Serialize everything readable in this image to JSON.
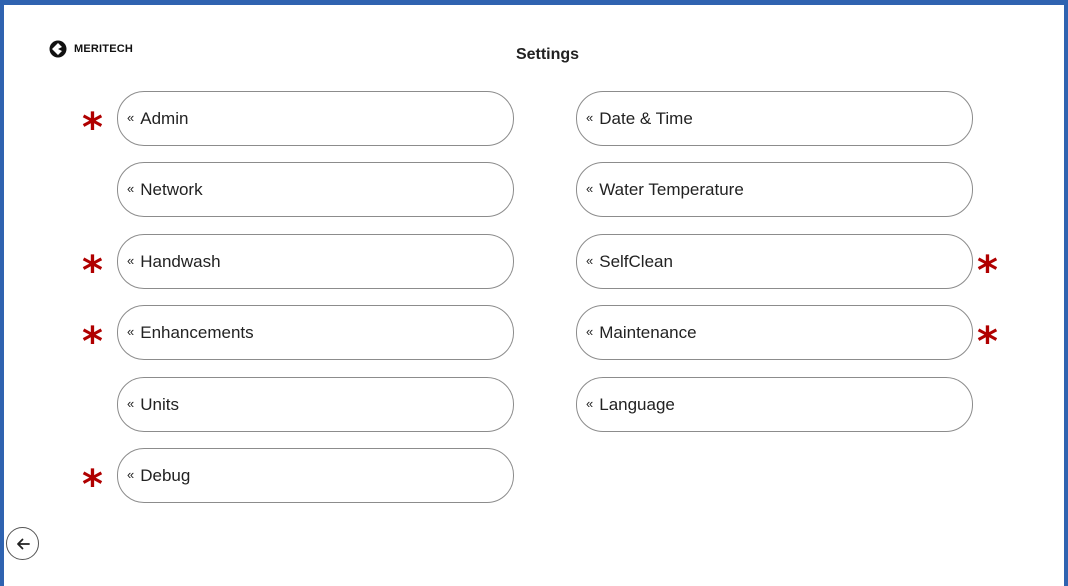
{
  "brand": {
    "name": "MERITECH"
  },
  "page": {
    "title": "Settings"
  },
  "chevron": "«",
  "left_column": [
    {
      "label": "Admin",
      "starred": true
    },
    {
      "label": "Network",
      "starred": false
    },
    {
      "label": "Handwash",
      "starred": true
    },
    {
      "label": "Enhancements",
      "starred": true
    },
    {
      "label": "Units",
      "starred": false
    },
    {
      "label": "Debug",
      "starred": true
    }
  ],
  "right_column": [
    {
      "label": "Date & Time",
      "starred": false
    },
    {
      "label": "Water Temperature",
      "starred": false
    },
    {
      "label": "SelfClean",
      "starred": true
    },
    {
      "label": "Maintenance",
      "starred": true
    },
    {
      "label": "Language",
      "starred": false
    }
  ],
  "star_symbol": "*",
  "colors": {
    "frame": "#2f63b0",
    "star": "#b00000",
    "button_border": "#8c8c8c"
  },
  "icons": {
    "back": "back-arrow-icon",
    "logo": "meritech-logo-icon"
  }
}
